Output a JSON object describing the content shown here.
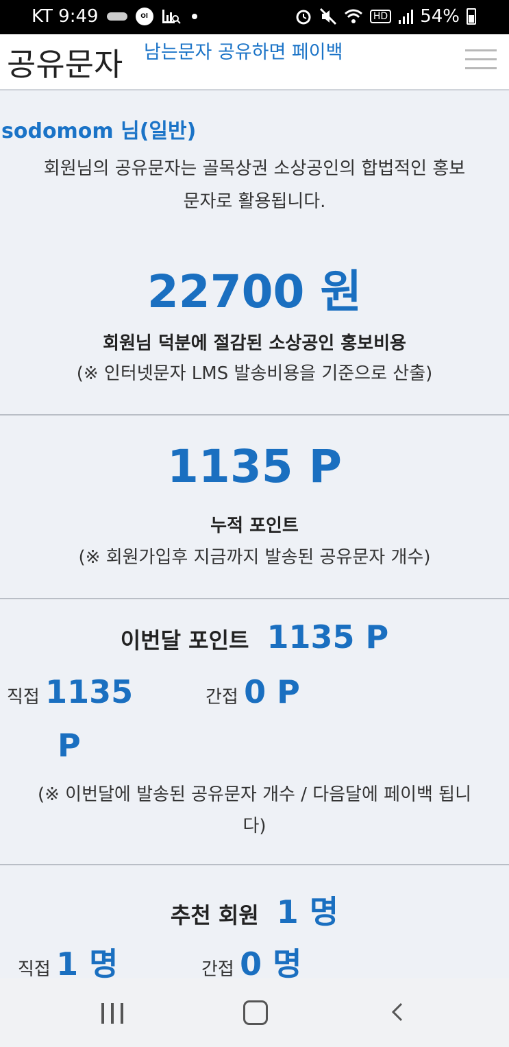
{
  "status_bar": {
    "carrier_time": "KT 9:49",
    "hd_label": "HD",
    "battery": "54%"
  },
  "header": {
    "title": "공유문자",
    "tagline": "남는문자 공유하면 페이백"
  },
  "summary": {
    "user": "sodomom 님(일반)",
    "intro_line1": "회원님의 공유문자는 골목상권 소상공인의 합법적인 홍보",
    "intro_line2": "문자로 활용됩니다.",
    "amount": "22700 원",
    "amount_caption": "회원님 덕분에 절감된 소상공인 홍보비용",
    "amount_note": "(※ 인터넷문자 LMS 발송비용을 기준으로 산출)"
  },
  "cumulative": {
    "points": "1135 P",
    "label": "누적 포인트",
    "note": "(※ 회원가입후 지금까지 발송된 공유문자 개수)"
  },
  "monthly": {
    "label": "이번달 포인트",
    "total": "1135 P",
    "direct_label": "직접",
    "direct_value_line1": "1135",
    "direct_value_line2": "P",
    "indirect_label": "간접",
    "indirect_value": "0 P",
    "note_line1": "(※ 이번달에 발송된 공유문자 개수 / 다음달에 페이백 됩니",
    "note_line2": "다)"
  },
  "referral": {
    "label": "추천 회원",
    "total": "1 명",
    "direct_label": "직접",
    "direct_value": "1 명",
    "indirect_label": "간접",
    "indirect_value": "0 명"
  },
  "colors": {
    "accent": "#1a6fc0",
    "background": "#eef1f6"
  }
}
